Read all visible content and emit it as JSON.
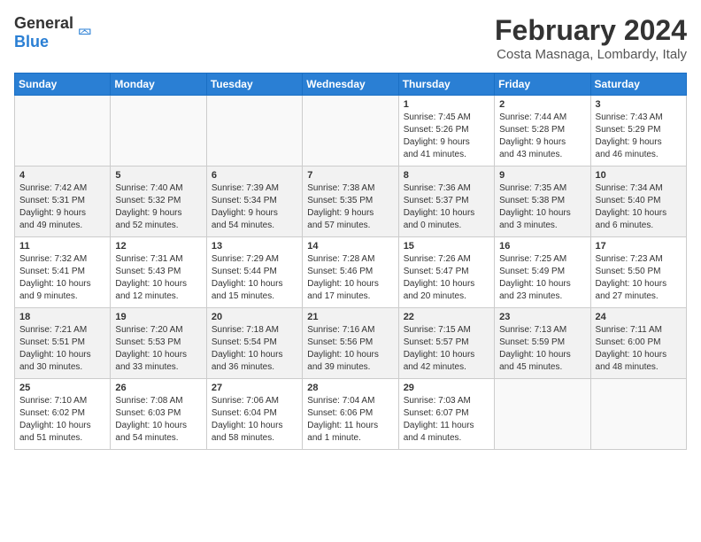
{
  "header": {
    "logo_general": "General",
    "logo_blue": "Blue",
    "month": "February 2024",
    "location": "Costa Masnaga, Lombardy, Italy"
  },
  "weekdays": [
    "Sunday",
    "Monday",
    "Tuesday",
    "Wednesday",
    "Thursday",
    "Friday",
    "Saturday"
  ],
  "weeks": [
    {
      "days": [
        {
          "num": "",
          "info": ""
        },
        {
          "num": "",
          "info": ""
        },
        {
          "num": "",
          "info": ""
        },
        {
          "num": "",
          "info": ""
        },
        {
          "num": "1",
          "info": "Sunrise: 7:45 AM\nSunset: 5:26 PM\nDaylight: 9 hours\nand 41 minutes."
        },
        {
          "num": "2",
          "info": "Sunrise: 7:44 AM\nSunset: 5:28 PM\nDaylight: 9 hours\nand 43 minutes."
        },
        {
          "num": "3",
          "info": "Sunrise: 7:43 AM\nSunset: 5:29 PM\nDaylight: 9 hours\nand 46 minutes."
        }
      ]
    },
    {
      "days": [
        {
          "num": "4",
          "info": "Sunrise: 7:42 AM\nSunset: 5:31 PM\nDaylight: 9 hours\nand 49 minutes."
        },
        {
          "num": "5",
          "info": "Sunrise: 7:40 AM\nSunset: 5:32 PM\nDaylight: 9 hours\nand 52 minutes."
        },
        {
          "num": "6",
          "info": "Sunrise: 7:39 AM\nSunset: 5:34 PM\nDaylight: 9 hours\nand 54 minutes."
        },
        {
          "num": "7",
          "info": "Sunrise: 7:38 AM\nSunset: 5:35 PM\nDaylight: 9 hours\nand 57 minutes."
        },
        {
          "num": "8",
          "info": "Sunrise: 7:36 AM\nSunset: 5:37 PM\nDaylight: 10 hours\nand 0 minutes."
        },
        {
          "num": "9",
          "info": "Sunrise: 7:35 AM\nSunset: 5:38 PM\nDaylight: 10 hours\nand 3 minutes."
        },
        {
          "num": "10",
          "info": "Sunrise: 7:34 AM\nSunset: 5:40 PM\nDaylight: 10 hours\nand 6 minutes."
        }
      ]
    },
    {
      "days": [
        {
          "num": "11",
          "info": "Sunrise: 7:32 AM\nSunset: 5:41 PM\nDaylight: 10 hours\nand 9 minutes."
        },
        {
          "num": "12",
          "info": "Sunrise: 7:31 AM\nSunset: 5:43 PM\nDaylight: 10 hours\nand 12 minutes."
        },
        {
          "num": "13",
          "info": "Sunrise: 7:29 AM\nSunset: 5:44 PM\nDaylight: 10 hours\nand 15 minutes."
        },
        {
          "num": "14",
          "info": "Sunrise: 7:28 AM\nSunset: 5:46 PM\nDaylight: 10 hours\nand 17 minutes."
        },
        {
          "num": "15",
          "info": "Sunrise: 7:26 AM\nSunset: 5:47 PM\nDaylight: 10 hours\nand 20 minutes."
        },
        {
          "num": "16",
          "info": "Sunrise: 7:25 AM\nSunset: 5:49 PM\nDaylight: 10 hours\nand 23 minutes."
        },
        {
          "num": "17",
          "info": "Sunrise: 7:23 AM\nSunset: 5:50 PM\nDaylight: 10 hours\nand 27 minutes."
        }
      ]
    },
    {
      "days": [
        {
          "num": "18",
          "info": "Sunrise: 7:21 AM\nSunset: 5:51 PM\nDaylight: 10 hours\nand 30 minutes."
        },
        {
          "num": "19",
          "info": "Sunrise: 7:20 AM\nSunset: 5:53 PM\nDaylight: 10 hours\nand 33 minutes."
        },
        {
          "num": "20",
          "info": "Sunrise: 7:18 AM\nSunset: 5:54 PM\nDaylight: 10 hours\nand 36 minutes."
        },
        {
          "num": "21",
          "info": "Sunrise: 7:16 AM\nSunset: 5:56 PM\nDaylight: 10 hours\nand 39 minutes."
        },
        {
          "num": "22",
          "info": "Sunrise: 7:15 AM\nSunset: 5:57 PM\nDaylight: 10 hours\nand 42 minutes."
        },
        {
          "num": "23",
          "info": "Sunrise: 7:13 AM\nSunset: 5:59 PM\nDaylight: 10 hours\nand 45 minutes."
        },
        {
          "num": "24",
          "info": "Sunrise: 7:11 AM\nSunset: 6:00 PM\nDaylight: 10 hours\nand 48 minutes."
        }
      ]
    },
    {
      "days": [
        {
          "num": "25",
          "info": "Sunrise: 7:10 AM\nSunset: 6:02 PM\nDaylight: 10 hours\nand 51 minutes."
        },
        {
          "num": "26",
          "info": "Sunrise: 7:08 AM\nSunset: 6:03 PM\nDaylight: 10 hours\nand 54 minutes."
        },
        {
          "num": "27",
          "info": "Sunrise: 7:06 AM\nSunset: 6:04 PM\nDaylight: 10 hours\nand 58 minutes."
        },
        {
          "num": "28",
          "info": "Sunrise: 7:04 AM\nSunset: 6:06 PM\nDaylight: 11 hours\nand 1 minute."
        },
        {
          "num": "29",
          "info": "Sunrise: 7:03 AM\nSunset: 6:07 PM\nDaylight: 11 hours\nand 4 minutes."
        },
        {
          "num": "",
          "info": ""
        },
        {
          "num": "",
          "info": ""
        }
      ]
    }
  ]
}
